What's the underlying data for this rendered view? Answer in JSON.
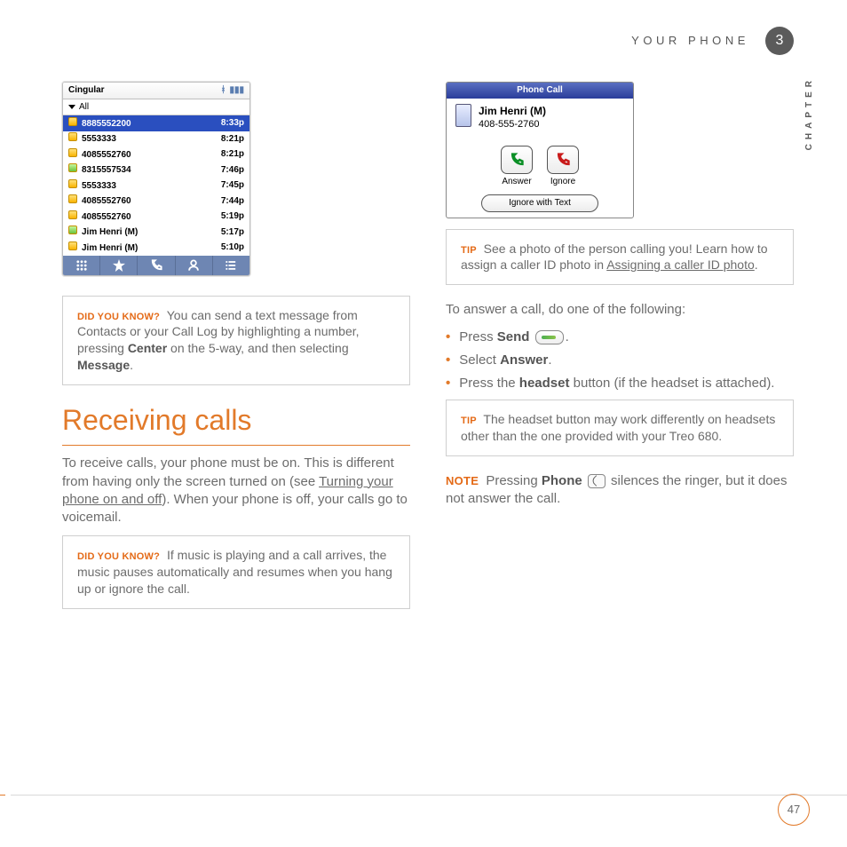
{
  "header": {
    "section": "YOUR PHONE",
    "chapter_number": "3",
    "chapter_label": "CHAPTER"
  },
  "page_number": "47",
  "callLog": {
    "carrier": "Cingular",
    "filter": "All",
    "rows": [
      {
        "kind": "out",
        "num": "8885552200",
        "time": "8:33p",
        "sel": true
      },
      {
        "kind": "out",
        "num": "5553333",
        "time": "8:21p"
      },
      {
        "kind": "out",
        "num": "4085552760",
        "time": "8:21p"
      },
      {
        "kind": "in",
        "num": "8315557534",
        "time": "7:46p"
      },
      {
        "kind": "out",
        "num": "5553333",
        "time": "7:45p"
      },
      {
        "kind": "out",
        "num": "4085552760",
        "time": "7:44p"
      },
      {
        "kind": "out",
        "num": "4085552760",
        "time": "5:19p"
      },
      {
        "kind": "in",
        "num": "Jim Henri  (M)",
        "time": "5:17p"
      },
      {
        "kind": "out",
        "num": "Jim Henri  (M)",
        "time": "5:10p"
      }
    ]
  },
  "phoneCall": {
    "title": "Phone Call",
    "name": "Jim Henri (M)",
    "number": "408-555-2760",
    "answer": "Answer",
    "ignore": "Ignore",
    "ignore_text": "Ignore with Text"
  },
  "left": {
    "dyk1_tag": "DID YOU KNOW?",
    "dyk1_a": "You can send a text message from Contacts or your Call Log by highlighting a number, pressing ",
    "dyk1_b": "Center",
    "dyk1_c": " on the 5-way, and then selecting ",
    "dyk1_d": "Message",
    "dyk1_e": ".",
    "h1": "Receiving calls",
    "p1_a": "To receive calls, your phone must be on. This is different from having only the screen turned on (see ",
    "p1_link": "Turning your phone on and off",
    "p1_b": "). When your phone is off, your calls go to voicemail.",
    "dyk2_tag": "DID YOU KNOW?",
    "dyk2": "If music is playing and a call arrives, the music pauses automatically and resumes when you hang up or ignore the call."
  },
  "right": {
    "tip1_tag": "TIP",
    "tip1_a": "See a photo of the person calling you! Learn how to assign a caller ID photo in ",
    "tip1_link": "Assigning a caller ID photo",
    "tip1_b": ".",
    "intro": "To answer a call, do one of the following:",
    "b1_a": "Press ",
    "b1_b": "Send",
    "b1_c": ".",
    "b2_a": "Select ",
    "b2_b": "Answer",
    "b2_c": ".",
    "b3_a": "Press the ",
    "b3_b": "headset",
    "b3_c": " button (if the headset is attached).",
    "tip2_tag": "TIP",
    "tip2": "The headset button may work differently on headsets other than the one provided with your Treo 680.",
    "note_tag": "NOTE",
    "note_a": "Pressing ",
    "note_b": "Phone",
    "note_c": " silences the ringer, but it does not answer the call."
  }
}
